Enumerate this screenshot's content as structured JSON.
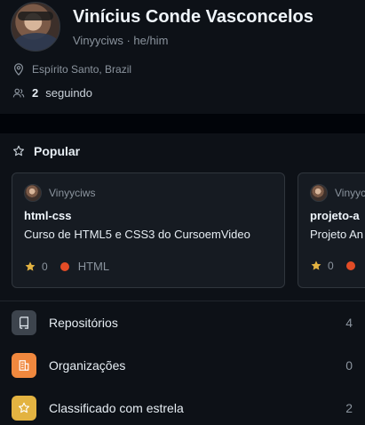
{
  "profile": {
    "name": "Vinícius Conde Vasconcelos",
    "handle_line": "Vinyyciws · he/him",
    "location": "Espírito Santo, Brazil",
    "following_count": "2",
    "following_word": "seguindo"
  },
  "popular": {
    "title": "Popular",
    "repos": [
      {
        "owner": "Vinyyciws",
        "name": "html-css",
        "description": "Curso de HTML5 e CSS3 do CursoemVideo",
        "stars": "0",
        "language": "HTML",
        "language_color": "#e34c26"
      },
      {
        "owner": "Vinyyciws",
        "name": "projeto-a",
        "description": "Projeto An",
        "stars": "0",
        "language": "",
        "language_color": "#e34c26"
      }
    ]
  },
  "menu": [
    {
      "label": "Repositórios",
      "count": "4",
      "icon": "repo-icon",
      "color": "#3d444d"
    },
    {
      "label": "Organizações",
      "count": "0",
      "icon": "organization-icon",
      "color": "#f0883e"
    },
    {
      "label": "Classificado com estrela",
      "count": "2",
      "icon": "star-icon",
      "color": "#e3b341"
    }
  ]
}
